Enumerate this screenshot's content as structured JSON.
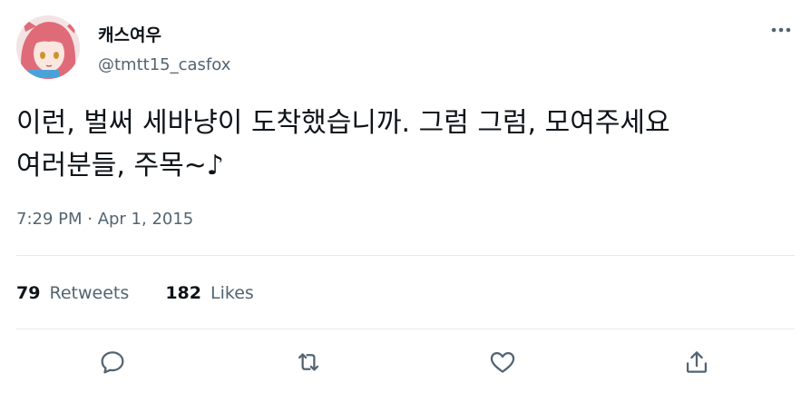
{
  "author": {
    "display_name": "캐스여우",
    "handle": "@tmtt15_casfox",
    "avatar_icon": "avatar-anime-foxgirl"
  },
  "tweet": {
    "text": "이런, 벌써 세바냥이 도착했습니까. 그럼 그럼, 모여주세요 여러분들, 주목~♪",
    "timestamp": "7:29 PM · Apr 1, 2015"
  },
  "stats": {
    "retweets_count": "79",
    "retweets_label": "Retweets",
    "likes_count": "182",
    "likes_label": "Likes"
  },
  "actions": [
    "reply-icon",
    "retweet-icon",
    "like-icon",
    "share-icon"
  ],
  "colors": {
    "text_primary": "#0f1419",
    "text_secondary": "#536471",
    "divider": "#e7e9ea",
    "icon": "#536471"
  }
}
